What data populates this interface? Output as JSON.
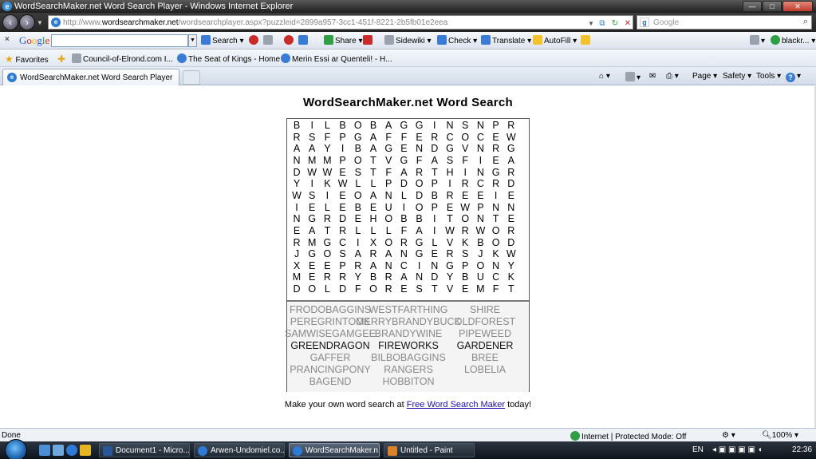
{
  "window": {
    "title": "WordSearchMaker.net Word Search Player - Windows Internet Explorer",
    "minimize_glyph": "—",
    "maximize_glyph": "□",
    "close_glyph": "✕"
  },
  "address_bar": {
    "url_prefix": "http://www.",
    "url_domain": "wordsearchmaker.net",
    "url_rest": "/wordsearchplayer.aspx?puzzleid=2899a957-3cc1-451f-8221-2b5fb01e2eea",
    "search_placeholder": "Google"
  },
  "google_toolbar": {
    "close_glyph": "×",
    "search_label": "Search",
    "share_label": "Share",
    "sidewiki_label": "Sidewiki",
    "check_label": "Check",
    "translate_label": "Translate",
    "autofill_label": "AutoFill",
    "account_label": "blackr...",
    "dropdown_glyph": "▾"
  },
  "favorites_bar": {
    "favorites_label": "Favorites",
    "links": [
      "Council-of-Elrond.com I...",
      "The Seat of Kings - Home ...",
      "Merin Essi ar Quenteli! - H..."
    ]
  },
  "tabs": {
    "active_label": "WordSearchMaker.net Word Search Player",
    "page_label": "Page",
    "safety_label": "Safety",
    "tools_label": "Tools",
    "help_glyph": "?"
  },
  "puzzle": {
    "title": "WordSearchMaker.net Word Search",
    "rows": [
      [
        "B",
        "I",
        "L",
        "B",
        "O",
        "B",
        "A",
        "G",
        "G",
        "I",
        "N",
        "S",
        "N",
        "P",
        "R"
      ],
      [
        "R",
        "S",
        "F",
        "P",
        "G",
        "A",
        "F",
        "F",
        "E",
        "R",
        "C",
        "O",
        "C",
        "E",
        "W"
      ],
      [
        "A",
        "A",
        "Y",
        "I",
        "B",
        "A",
        "G",
        "E",
        "N",
        "D",
        "G",
        "V",
        "N",
        "R",
        "G"
      ],
      [
        "N",
        "M",
        "M",
        "P",
        "O",
        "T",
        "V",
        "G",
        "F",
        "A",
        "S",
        "F",
        "I",
        "E",
        "A"
      ],
      [
        "D",
        "W",
        "W",
        "E",
        "S",
        "T",
        "F",
        "A",
        "R",
        "T",
        "H",
        "I",
        "N",
        "G",
        "R"
      ],
      [
        "Y",
        "I",
        "K",
        "W",
        "L",
        "L",
        "P",
        "D",
        "O",
        "P",
        "I",
        "R",
        "C",
        "R",
        "D"
      ],
      [
        "W",
        "S",
        "I",
        "E",
        "O",
        "A",
        "N",
        "L",
        "D",
        "B",
        "R",
        "E",
        "E",
        "I",
        "E"
      ],
      [
        "I",
        "E",
        "L",
        "E",
        "B",
        "E",
        "U",
        "I",
        "O",
        "P",
        "E",
        "W",
        "P",
        "N",
        "N"
      ],
      [
        "N",
        "G",
        "R",
        "D",
        "E",
        "H",
        "O",
        "B",
        "B",
        "I",
        "T",
        "O",
        "N",
        "T",
        "E"
      ],
      [
        "E",
        "A",
        "T",
        "R",
        "L",
        "L",
        "L",
        "F",
        "A",
        "I",
        "W",
        "R",
        "W",
        "O",
        "R"
      ],
      [
        "R",
        "M",
        "G",
        "C",
        "I",
        "X",
        "O",
        "R",
        "G",
        "L",
        "V",
        "K",
        "B",
        "O",
        "D"
      ],
      [
        "J",
        "G",
        "O",
        "S",
        "A",
        "R",
        "A",
        "N",
        "G",
        "E",
        "R",
        "S",
        "J",
        "K",
        "W"
      ],
      [
        "X",
        "E",
        "E",
        "P",
        "R",
        "A",
        "N",
        "C",
        "I",
        "N",
        "G",
        "P",
        "O",
        "N",
        "Y"
      ],
      [
        "M",
        "E",
        "R",
        "R",
        "Y",
        "B",
        "R",
        "A",
        "N",
        "D",
        "Y",
        "B",
        "U",
        "C",
        "K"
      ],
      [
        "D",
        "O",
        "L",
        "D",
        "F",
        "O",
        "R",
        "E",
        "S",
        "T",
        "V",
        "E",
        "M",
        "F",
        "T"
      ]
    ],
    "words": [
      {
        "text": "FRODOBAGGINS",
        "found": false
      },
      {
        "text": "WESTFARTHING",
        "found": false
      },
      {
        "text": "SHIRE",
        "found": false
      },
      {
        "text": "PEREGRINTOOK",
        "found": false
      },
      {
        "text": "MERRYBRANDYBUCK",
        "found": false
      },
      {
        "text": "OLDFOREST",
        "found": false
      },
      {
        "text": "SAMWISEGAMGEE",
        "found": false
      },
      {
        "text": "BRANDYWINE",
        "found": false
      },
      {
        "text": "PIPEWEED",
        "found": false
      },
      {
        "text": "GREENDRAGON",
        "found": true
      },
      {
        "text": "FIREWORKS",
        "found": true
      },
      {
        "text": "GARDENER",
        "found": true
      },
      {
        "text": "GAFFER",
        "found": false
      },
      {
        "text": "BILBOBAGGINS",
        "found": false
      },
      {
        "text": "BREE",
        "found": false
      },
      {
        "text": "PRANCINGPONY",
        "found": false
      },
      {
        "text": "RANGERS",
        "found": false
      },
      {
        "text": "LOBELIA",
        "found": false
      },
      {
        "text": "BAGEND",
        "found": false
      },
      {
        "text": "HOBBITON",
        "found": false
      }
    ],
    "footer_prefix": "Make your own word search at ",
    "footer_link": "Free Word Search Maker",
    "footer_suffix": " today!"
  },
  "status_bar": {
    "status": "Done",
    "zone": "Internet | Protected Mode: Off",
    "zoom": "100%"
  },
  "taskbar": {
    "tasks": [
      "Document1 - Micro...",
      "Arwen-Undomiel.co...",
      "WordSearchMaker.n...",
      "Untitled - Paint"
    ],
    "language": "EN",
    "clock": "22:36"
  }
}
